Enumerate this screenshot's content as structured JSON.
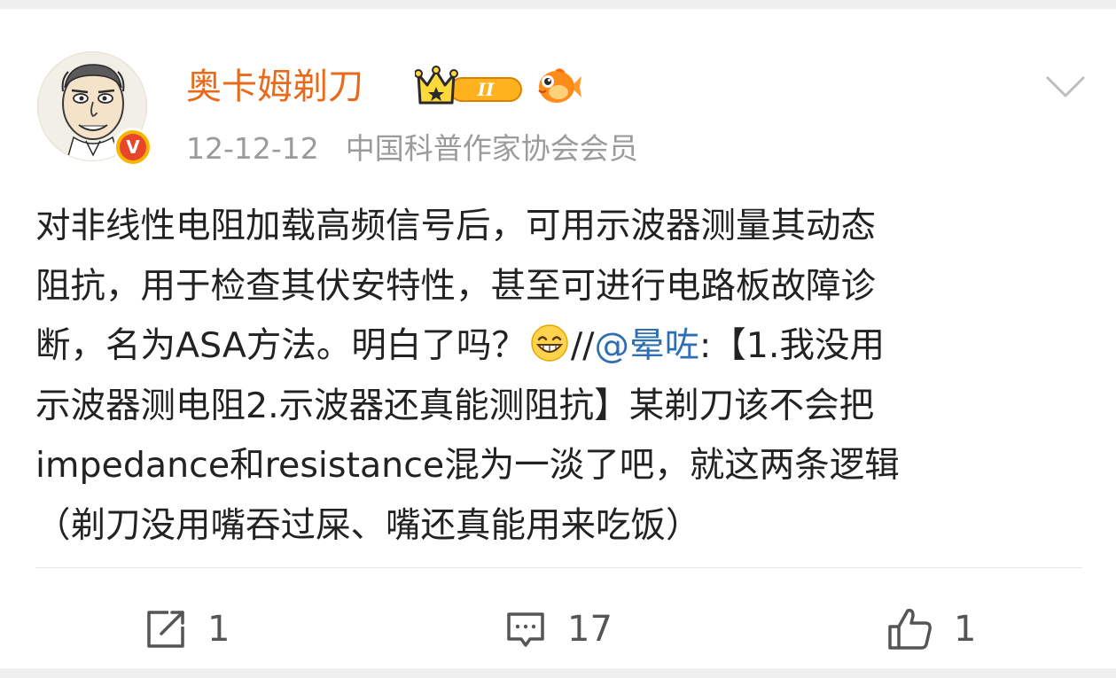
{
  "post": {
    "author": {
      "name": "奥卡姆剃刀",
      "vip_level": "II",
      "verified": true
    },
    "date": "12-12-12",
    "source": "中国科普作家协会会员",
    "content": {
      "line1": "对非线性电阻加载高频信号后，可用示波器测量其动态",
      "line2": "阻抗，用于检查其伏安特性，甚至可进行电路板故障诊",
      "line3_before_emoji": "断，名为ASA方法。明白了吗？",
      "line3_after_emoji": "//",
      "mention": "@晕咗",
      "line3_after_mention": ":【1.我没用",
      "line4": "示波器测电阻2.示波器还真能测阻抗】某剃刀该不会把",
      "line5": "impedance和resistance混为一淡了吧，就这两条逻辑",
      "line6": "（剃刀没用嘴吞过屎、嘴还真能用来吃饭）"
    },
    "emoji": "grin-icon"
  },
  "actions": {
    "repost_count": "1",
    "comment_count": "17",
    "like_count": "1"
  },
  "colors": {
    "author_name": "#e86a1a",
    "mention": "#2e6fb4",
    "meta": "#9b9b9b",
    "text": "#222222"
  }
}
